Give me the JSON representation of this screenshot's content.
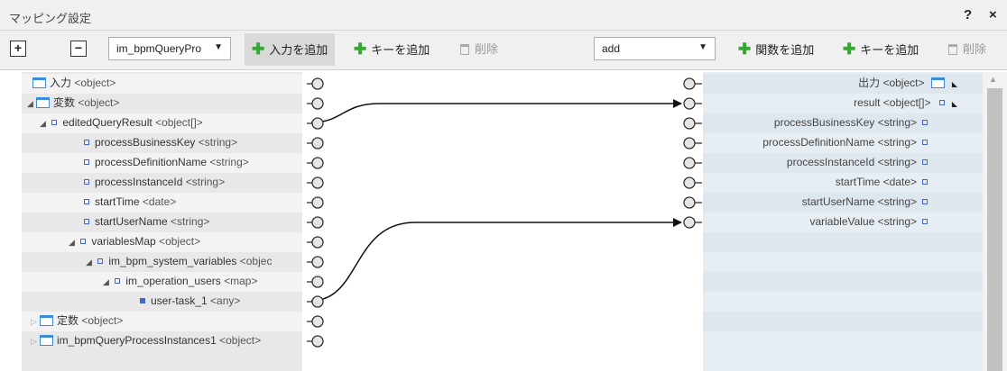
{
  "window": {
    "title": "マッピング設定",
    "help": "?",
    "close": "×"
  },
  "toolbar": {
    "expand_label": "+",
    "collapse_label": "−",
    "source_select": "im_bpmQueryPro",
    "add_input_label": "入力を追加",
    "add_key_label_left": "キーを追加",
    "delete_label_left": "削除",
    "function_select": "add",
    "add_function_label": "関数を追加",
    "add_key_label_right": "キーを追加",
    "delete_label_right": "削除",
    "caret": "▼"
  },
  "left_tree": [
    {
      "name": "入力",
      "type": "<object>"
    },
    {
      "name": "変数",
      "type": "<object>"
    },
    {
      "name": "editedQueryResult",
      "type": "<object[]>"
    },
    {
      "name": "processBusinessKey",
      "type": "<string>"
    },
    {
      "name": "processDefinitionName",
      "type": "<string>"
    },
    {
      "name": "processInstanceId",
      "type": "<string>"
    },
    {
      "name": "startTime",
      "type": "<date>"
    },
    {
      "name": "startUserName",
      "type": "<string>"
    },
    {
      "name": "variablesMap",
      "type": "<object>"
    },
    {
      "name": "im_bpm_system_variables",
      "type": "<objec"
    },
    {
      "name": "im_operation_users",
      "type": "<map>"
    },
    {
      "name": "user-task_1",
      "type": "<any>"
    },
    {
      "name": "定数",
      "type": "<object>"
    },
    {
      "name": "im_bpmQueryProcessInstances1",
      "type": "<object>"
    }
  ],
  "right_tree": [
    {
      "name": "出力",
      "type": "<object>"
    },
    {
      "name": "result",
      "type": "<object[]>"
    },
    {
      "name": "processBusinessKey",
      "type": "<string>"
    },
    {
      "name": "processDefinitionName",
      "type": "<string>"
    },
    {
      "name": "processInstanceId",
      "type": "<string>"
    },
    {
      "name": "startTime",
      "type": "<date>"
    },
    {
      "name": "startUserName",
      "type": "<string>"
    },
    {
      "name": "variableValue",
      "type": "<string>"
    }
  ],
  "icons": {
    "tree_open": "◢",
    "tree_closed": "▷",
    "corner": "◣",
    "scroll_up": "▲",
    "plus": "✚"
  },
  "colors": {
    "accent_green": "#36a832",
    "link_blue": "#3b8bd8",
    "connector": "#111111"
  }
}
